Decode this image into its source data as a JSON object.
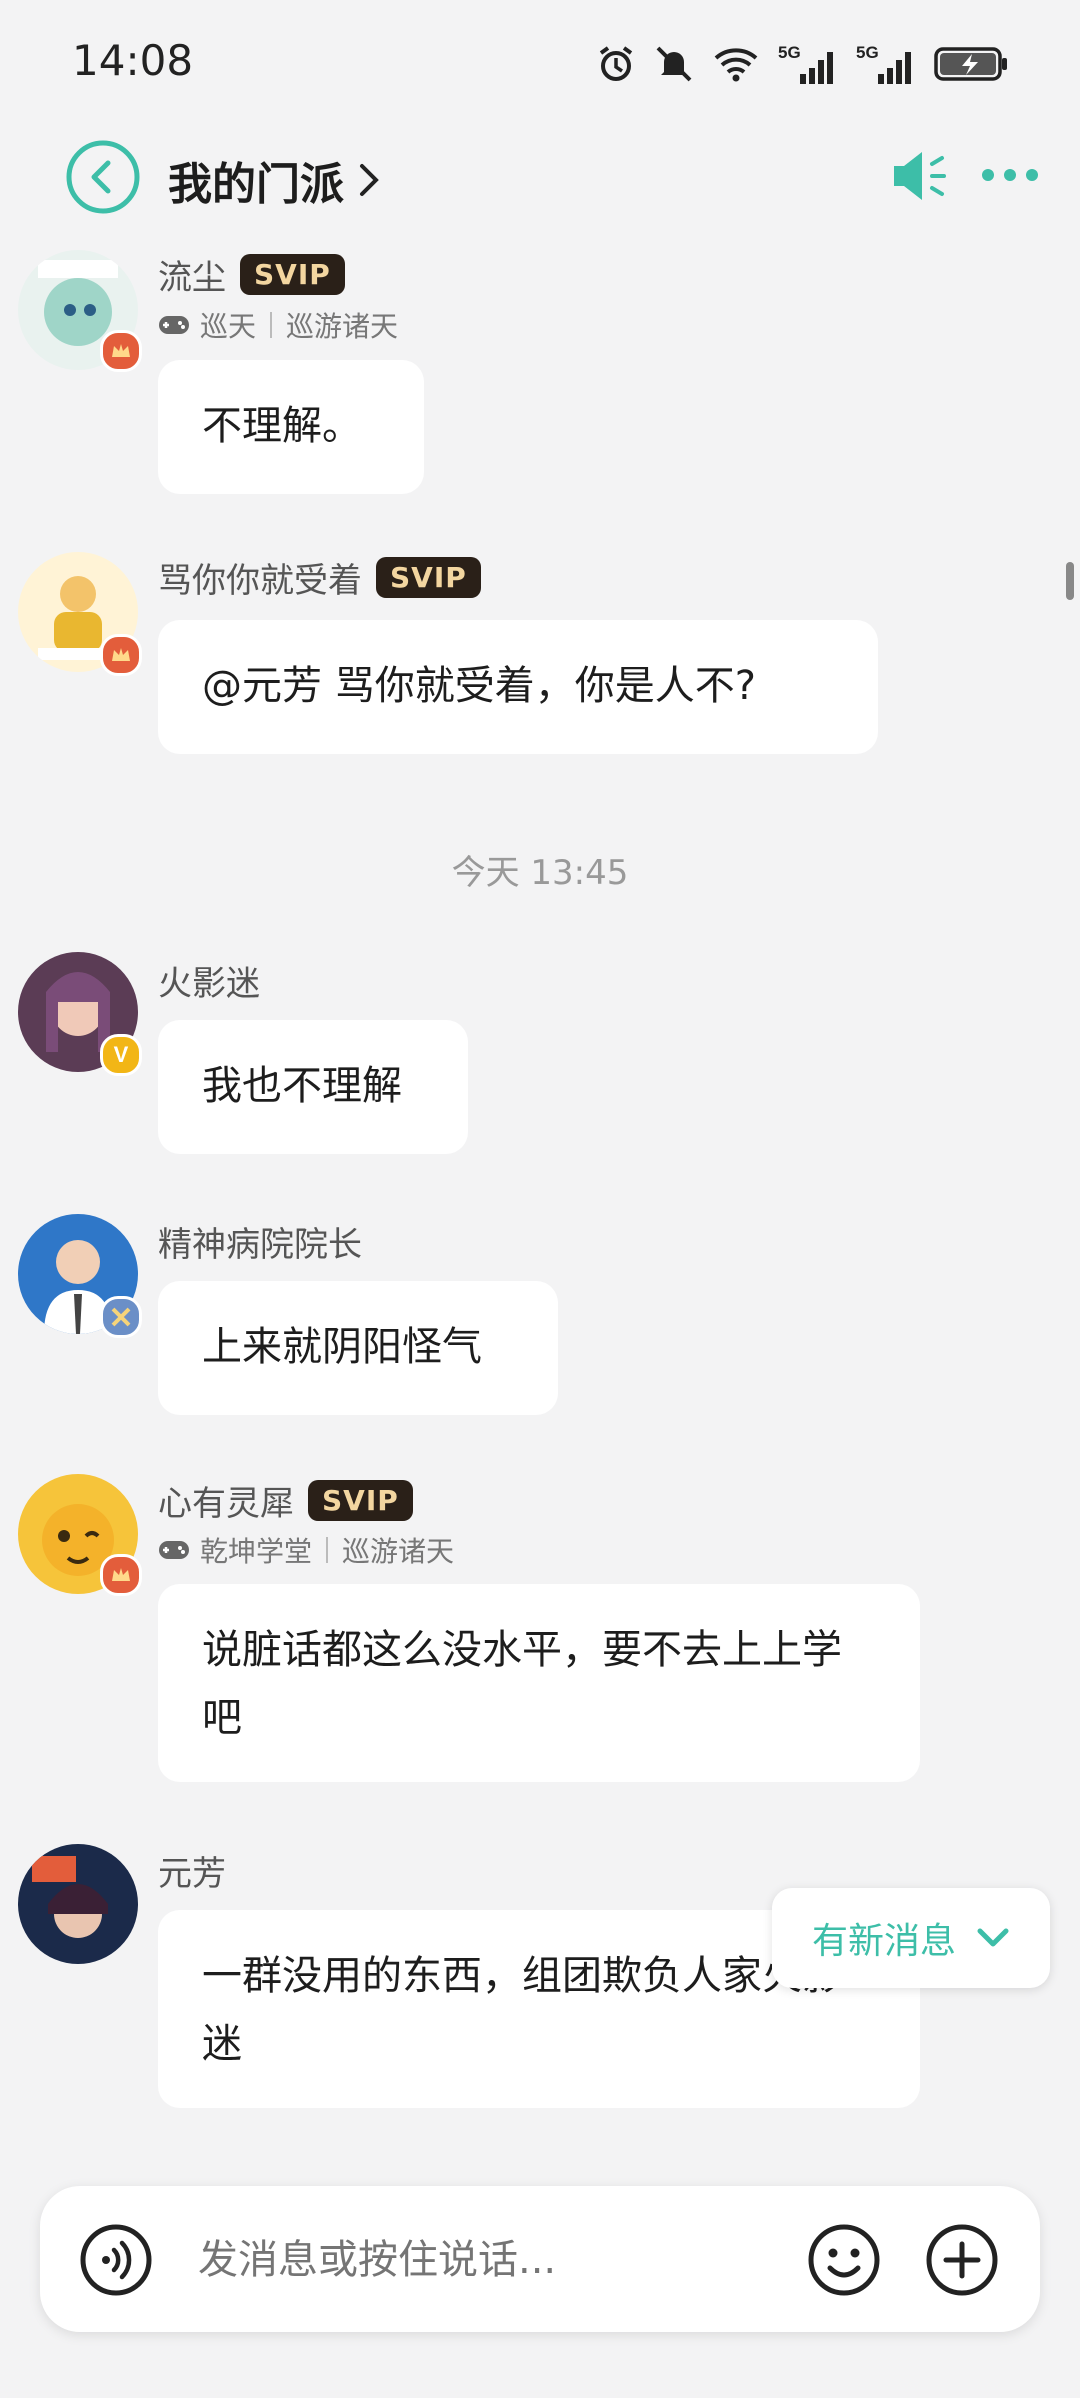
{
  "status_bar": {
    "time": "14:08",
    "icons": [
      "alarm-icon",
      "mute-icon",
      "wifi-icon",
      "signal-5g-icon",
      "signal-5g-icon",
      "battery-charging-icon"
    ],
    "network_labels": [
      "5G",
      "5G"
    ]
  },
  "header": {
    "title": "我的门派",
    "accent_color": "#3dbea8"
  },
  "messages": [
    {
      "name": "流尘",
      "svip": "SVIP",
      "game": "巡天",
      "game_detail": "巡游诸天",
      "text": "不理解。"
    },
    {
      "name": "骂你你就受着",
      "svip": "SVIP",
      "text": "@元芳 骂你就受着，你是人不?"
    },
    {
      "name": "火影迷",
      "text": "我也不理解"
    },
    {
      "name": "精神病院院长",
      "text": "上来就阴阳怪气"
    },
    {
      "name": "心有灵犀",
      "svip": "SVIP",
      "game": "乾坤学堂",
      "game_detail": "巡游诸天",
      "text": "说脏话都这么没水平，要不去上上学吧"
    },
    {
      "name": "元芳",
      "text": "一群没用的东西，组团欺负人家火影迷"
    }
  ],
  "timestamp": "今天 13:45",
  "new_message_pill": "有新消息",
  "input": {
    "placeholder": "发消息或按住说话..."
  }
}
